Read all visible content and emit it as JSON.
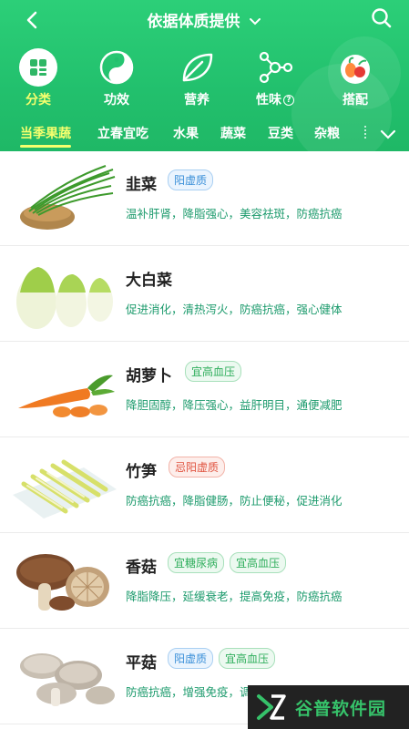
{
  "header": {
    "title": "依据体质提供",
    "colors": {
      "bg_top": "#2ccf78",
      "bg_bottom": "#1fb866",
      "active": "#f5ff6e"
    }
  },
  "categories": [
    {
      "label": "分类",
      "icon": "grid-icon",
      "active": true
    },
    {
      "label": "功效",
      "icon": "yin-yang-icon",
      "active": false
    },
    {
      "label": "营养",
      "icon": "leaf-icon",
      "active": false
    },
    {
      "label": "性味",
      "icon": "molecule-icon",
      "active": false,
      "badge": "?"
    },
    {
      "label": "搭配",
      "icon": "fruit-basket-icon",
      "active": false
    }
  ],
  "tabs": [
    {
      "label": "当季果蔬",
      "active": true
    },
    {
      "label": "立春宜吃",
      "active": false
    },
    {
      "label": "水果",
      "active": false
    },
    {
      "label": "蔬菜",
      "active": false
    },
    {
      "label": "豆类",
      "active": false
    },
    {
      "label": "杂粮",
      "active": false
    }
  ],
  "items": [
    {
      "name": "韭菜",
      "tags": [
        {
          "text": "阳虚质",
          "color": "blue"
        }
      ],
      "effects": "温补肝肾，降脂强心，美容祛斑，防癌抗癌",
      "image": "chives-image"
    },
    {
      "name": "大白菜",
      "tags": [],
      "effects": "促进消化，清热泻火，防癌抗癌，强心健体",
      "image": "napa-cabbage-image"
    },
    {
      "name": "胡萝卜",
      "tags": [
        {
          "text": "宜高血压",
          "color": "green"
        }
      ],
      "effects": "降胆固醇，降压强心，益肝明目，通便减肥",
      "image": "carrot-image"
    },
    {
      "name": "竹笋",
      "tags": [
        {
          "text": "忌阳虚质",
          "color": "red"
        }
      ],
      "effects": "防癌抗癌，降脂健肠，防止便秘，促进消化",
      "image": "bamboo-shoots-image"
    },
    {
      "name": "香菇",
      "tags": [
        {
          "text": "宜糖尿病",
          "color": "green"
        },
        {
          "text": "宜高血压",
          "color": "green"
        }
      ],
      "effects": "降脂降压，延缓衰老，提高免疫，防癌抗癌",
      "image": "shiitake-image"
    },
    {
      "name": "平菇",
      "tags": [
        {
          "text": "阳虚质",
          "color": "blue"
        },
        {
          "text": "宜高血压",
          "color": "green"
        }
      ],
      "effects": "防癌抗癌，增强免疫，调理",
      "image": "oyster-mushroom-image"
    }
  ],
  "watermark": {
    "text": "谷普软件园"
  }
}
